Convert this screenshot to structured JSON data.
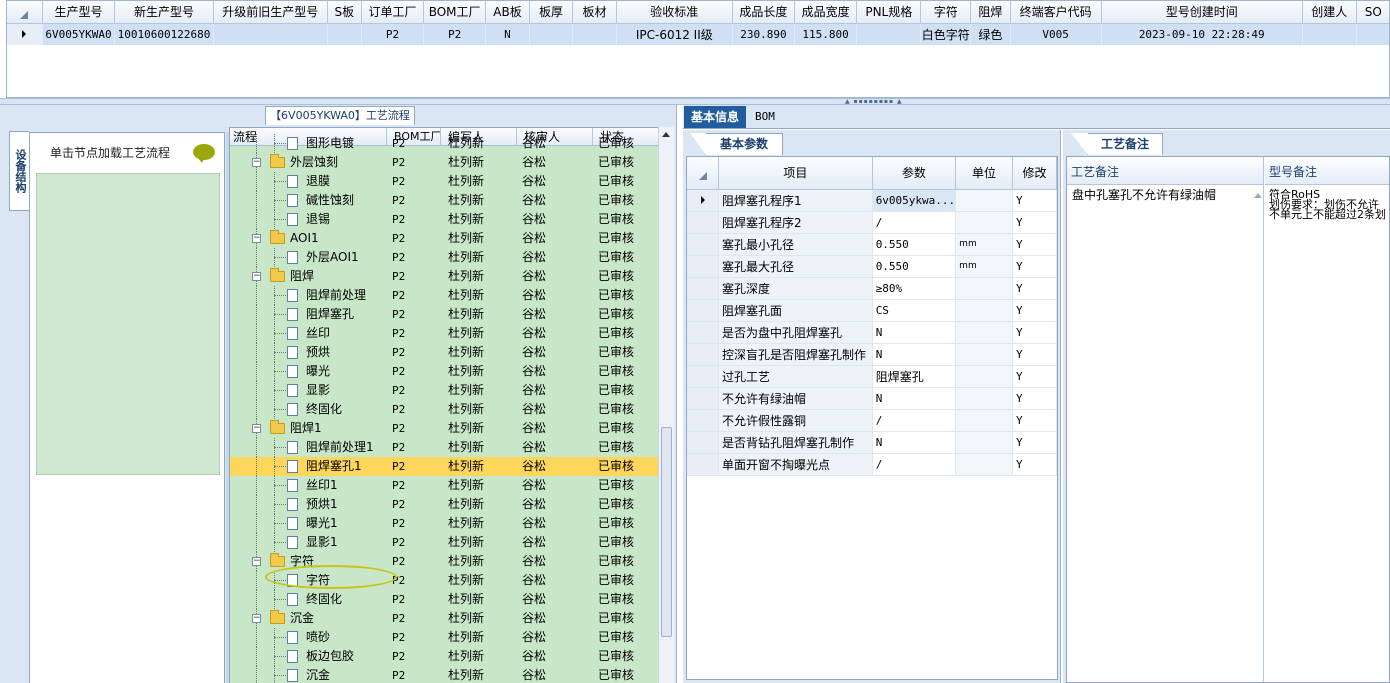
{
  "top_grid": {
    "columns": [
      "生产型号",
      "新生产型号",
      "升级前旧生产型号",
      "S板",
      "订单工厂",
      "BOM工厂",
      "AB板",
      "板厚",
      "板材",
      "验收标准",
      "成品长度",
      "成品宽度",
      "PNL规格",
      "字符",
      "阻焊",
      "终端客户代码",
      "型号创建时间",
      "创建人",
      "SO"
    ],
    "row": [
      "6V005YKWA0",
      "10010600122680",
      "",
      "",
      "P2",
      "P2",
      "N",
      "",
      "",
      "IPC-6012 II级",
      "230.890",
      "115.800",
      "",
      "白色字符",
      "绿色",
      "V005",
      "2023-09-10 22:28:49",
      "",
      ""
    ]
  },
  "flow_panel": {
    "title": "【6V005YKWA0】工艺流程",
    "vertical_tab": "设备结构",
    "load_hint": "单击节点加载工艺流程"
  },
  "tree": {
    "headers": [
      "流程",
      "BOM工厂",
      "编写人",
      "核审人",
      "状态"
    ],
    "rows": [
      {
        "name": "图形电镀",
        "level": 2,
        "type": "doc",
        "bom": "P2",
        "writer": "杜列新",
        "reviewer": "谷松",
        "status": "已审核"
      },
      {
        "name": "外层蚀刻",
        "level": 1,
        "type": "folder",
        "bom": "P2",
        "writer": "杜列新",
        "reviewer": "谷松",
        "status": "已审核"
      },
      {
        "name": "退膜",
        "level": 2,
        "type": "doc",
        "bom": "P2",
        "writer": "杜列新",
        "reviewer": "谷松",
        "status": "已审核"
      },
      {
        "name": "碱性蚀刻",
        "level": 2,
        "type": "doc",
        "bom": "P2",
        "writer": "杜列新",
        "reviewer": "谷松",
        "status": "已审核"
      },
      {
        "name": "退锡",
        "level": 2,
        "type": "doc",
        "bom": "P2",
        "writer": "杜列新",
        "reviewer": "谷松",
        "status": "已审核"
      },
      {
        "name": "AOI1",
        "level": 1,
        "type": "folder",
        "bom": "P2",
        "writer": "杜列新",
        "reviewer": "谷松",
        "status": "已审核"
      },
      {
        "name": "外层AOI1",
        "level": 2,
        "type": "doc",
        "bom": "P2",
        "writer": "杜列新",
        "reviewer": "谷松",
        "status": "已审核"
      },
      {
        "name": "阻焊",
        "level": 1,
        "type": "folder",
        "bom": "P2",
        "writer": "杜列新",
        "reviewer": "谷松",
        "status": "已审核"
      },
      {
        "name": "阻焊前处理",
        "level": 2,
        "type": "doc",
        "bom": "P2",
        "writer": "杜列新",
        "reviewer": "谷松",
        "status": "已审核"
      },
      {
        "name": "阻焊塞孔",
        "level": 2,
        "type": "doc",
        "bom": "P2",
        "writer": "杜列新",
        "reviewer": "谷松",
        "status": "已审核"
      },
      {
        "name": "丝印",
        "level": 2,
        "type": "doc",
        "bom": "P2",
        "writer": "杜列新",
        "reviewer": "谷松",
        "status": "已审核"
      },
      {
        "name": "预烘",
        "level": 2,
        "type": "doc",
        "bom": "P2",
        "writer": "杜列新",
        "reviewer": "谷松",
        "status": "已审核"
      },
      {
        "name": "曝光",
        "level": 2,
        "type": "doc",
        "bom": "P2",
        "writer": "杜列新",
        "reviewer": "谷松",
        "status": "已审核"
      },
      {
        "name": "显影",
        "level": 2,
        "type": "doc",
        "bom": "P2",
        "writer": "杜列新",
        "reviewer": "谷松",
        "status": "已审核"
      },
      {
        "name": "终固化",
        "level": 2,
        "type": "doc",
        "bom": "P2",
        "writer": "杜列新",
        "reviewer": "谷松",
        "status": "已审核"
      },
      {
        "name": "阻焊1",
        "level": 1,
        "type": "folder",
        "bom": "P2",
        "writer": "杜列新",
        "reviewer": "谷松",
        "status": "已审核"
      },
      {
        "name": "阻焊前处理1",
        "level": 2,
        "type": "doc",
        "bom": "P2",
        "writer": "杜列新",
        "reviewer": "谷松",
        "status": "已审核"
      },
      {
        "name": "阻焊塞孔1",
        "level": 2,
        "type": "doc",
        "bom": "P2",
        "writer": "杜列新",
        "reviewer": "谷松",
        "status": "已审核",
        "selected": true
      },
      {
        "name": "丝印1",
        "level": 2,
        "type": "doc",
        "bom": "P2",
        "writer": "杜列新",
        "reviewer": "谷松",
        "status": "已审核"
      },
      {
        "name": "预烘1",
        "level": 2,
        "type": "doc",
        "bom": "P2",
        "writer": "杜列新",
        "reviewer": "谷松",
        "status": "已审核"
      },
      {
        "name": "曝光1",
        "level": 2,
        "type": "doc",
        "bom": "P2",
        "writer": "杜列新",
        "reviewer": "谷松",
        "status": "已审核"
      },
      {
        "name": "显影1",
        "level": 2,
        "type": "doc",
        "bom": "P2",
        "writer": "杜列新",
        "reviewer": "谷松",
        "status": "已审核"
      },
      {
        "name": "字符",
        "level": 1,
        "type": "folder",
        "bom": "P2",
        "writer": "杜列新",
        "reviewer": "谷松",
        "status": "已审核"
      },
      {
        "name": "字符",
        "level": 2,
        "type": "doc",
        "bom": "P2",
        "writer": "杜列新",
        "reviewer": "谷松",
        "status": "已审核"
      },
      {
        "name": "终固化",
        "level": 2,
        "type": "doc",
        "bom": "P2",
        "writer": "杜列新",
        "reviewer": "谷松",
        "status": "已审核"
      },
      {
        "name": "沉金",
        "level": 1,
        "type": "folder",
        "bom": "P2",
        "writer": "杜列新",
        "reviewer": "谷松",
        "status": "已审核"
      },
      {
        "name": "喷砂",
        "level": 2,
        "type": "doc",
        "bom": "P2",
        "writer": "杜列新",
        "reviewer": "谷松",
        "status": "已审核"
      },
      {
        "name": "板边包胶",
        "level": 2,
        "type": "doc",
        "bom": "P2",
        "writer": "杜列新",
        "reviewer": "谷松",
        "status": "已审核"
      },
      {
        "name": "沉金",
        "level": 2,
        "type": "doc",
        "bom": "P2",
        "writer": "杜列新",
        "reviewer": "谷松",
        "status": "已审核"
      }
    ]
  },
  "right_tabs": {
    "basic": "基本信息",
    "bom": "BOM"
  },
  "params": {
    "tab": "基本参数",
    "headers": [
      "项目",
      "参数",
      "单位",
      "修改"
    ],
    "rows": [
      {
        "item": "阻焊塞孔程序1",
        "value": "6v005ykwa...",
        "unit": "",
        "edit": "Y"
      },
      {
        "item": "阻焊塞孔程序2",
        "value": "/",
        "unit": "",
        "edit": "Y"
      },
      {
        "item": "塞孔最小孔径",
        "value": "0.550",
        "unit": "mm",
        "edit": "Y"
      },
      {
        "item": "塞孔最大孔径",
        "value": "0.550",
        "unit": "mm",
        "edit": "Y"
      },
      {
        "item": "塞孔深度",
        "value": "≥80%",
        "unit": "",
        "edit": "Y"
      },
      {
        "item": "阻焊塞孔面",
        "value": "CS",
        "unit": "",
        "edit": "Y"
      },
      {
        "item": "是否为盘中孔阻焊塞孔",
        "value": "N",
        "unit": "",
        "edit": "Y"
      },
      {
        "item": "控深盲孔是否阻焊塞孔制作",
        "value": "N",
        "unit": "",
        "edit": "Y"
      },
      {
        "item": "过孔工艺",
        "value": "阻焊塞孔",
        "unit": "",
        "edit": "Y"
      },
      {
        "item": "不允许有绿油帽",
        "value": "N",
        "unit": "",
        "edit": "Y"
      },
      {
        "item": "不允许假性露铜",
        "value": "/",
        "unit": "",
        "edit": "Y"
      },
      {
        "item": "是否背钻孔阻焊塞孔制作",
        "value": "N",
        "unit": "",
        "edit": "Y"
      },
      {
        "item": "单面开窗不掏曝光点",
        "value": "/",
        "unit": "",
        "edit": "Y"
      }
    ]
  },
  "remarks": {
    "tab": "工艺备注",
    "col1_header": "工艺备注",
    "col1_text": "盘中孔塞孔不允许有绿油帽",
    "col2_header": "型号备注",
    "col2_lines": [
      "符合RoHS",
      "划伤要求：划伤不允许",
      "不单元上不能超过2条划"
    ]
  }
}
